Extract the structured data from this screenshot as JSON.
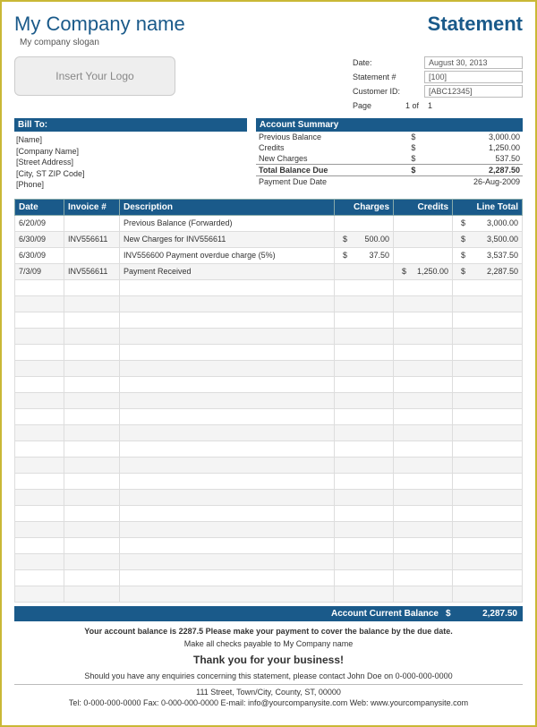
{
  "header": {
    "company_name": "My Company name",
    "slogan": "My company slogan",
    "doc_title": "Statement",
    "logo_placeholder": "Insert Your Logo"
  },
  "meta": {
    "date_label": "Date:",
    "date_value": "August 30, 2013",
    "stmt_label": "Statement #",
    "stmt_value": "[100]",
    "cust_label": "Customer ID:",
    "cust_value": "[ABC12345]",
    "page_label": "Page",
    "page_mid": "1 of",
    "page_total": "1"
  },
  "billto": {
    "title": "Bill To:",
    "lines": [
      "[Name]",
      "[Company Name]",
      "[Street Address]",
      "[City, ST  ZIP Code]",
      "[Phone]"
    ]
  },
  "acct": {
    "title": "Account Summary",
    "rows": [
      {
        "label": "Previous Balance",
        "cur": "$",
        "amt": "3,000.00"
      },
      {
        "label": "Credits",
        "cur": "$",
        "amt": "1,250.00"
      },
      {
        "label": "New Charges",
        "cur": "$",
        "amt": "537.50"
      }
    ],
    "total_label": "Total Balance Due",
    "total_cur": "$",
    "total_amt": "2,287.50",
    "due_label": "Payment Due Date",
    "due_val": "26-Aug-2009"
  },
  "grid": {
    "headers": [
      "Date",
      "Invoice #",
      "Description",
      "Charges",
      "Credits",
      "Line Total"
    ],
    "rows": [
      {
        "date": "6/20/09",
        "inv": "",
        "desc": "Previous Balance (Forwarded)",
        "chg_c": "",
        "chg": "",
        "cr_c": "",
        "cr": "",
        "lt_c": "$",
        "lt": "3,000.00"
      },
      {
        "date": "6/30/09",
        "inv": "INV556611",
        "desc": "New Charges for INV556611",
        "chg_c": "$",
        "chg": "500.00",
        "cr_c": "",
        "cr": "",
        "lt_c": "$",
        "lt": "3,500.00"
      },
      {
        "date": "6/30/09",
        "inv": "",
        "desc": "INV556600 Payment overdue charge (5%)",
        "chg_c": "$",
        "chg": "37.50",
        "cr_c": "",
        "cr": "",
        "lt_c": "$",
        "lt": "3,537.50"
      },
      {
        "date": "7/3/09",
        "inv": "INV556611",
        "desc": "Payment Received",
        "chg_c": "",
        "chg": "",
        "cr_c": "$",
        "cr": "1,250.00",
        "lt_c": "$",
        "lt": "2,287.50"
      }
    ],
    "blank_rows": 20
  },
  "balance": {
    "label": "Account Current Balance",
    "cur": "$",
    "val": "2,287.50"
  },
  "footer": {
    "bold_note": "Your account balance is 2287.5 Please make your payment to cover the balance by the due date.",
    "pay_to": "Make all checks payable to My Company name",
    "thanks": "Thank you for your business!",
    "enq": "Should you have any enquiries concerning this statement, please contact John Doe on 0-000-000-0000",
    "addr": "111 Street, Town/City, County, ST, 00000",
    "contacts": "Tel: 0-000-000-0000 Fax: 0-000-000-0000 E-mail: info@yourcompanysite.com Web: www.yourcompanysite.com"
  }
}
